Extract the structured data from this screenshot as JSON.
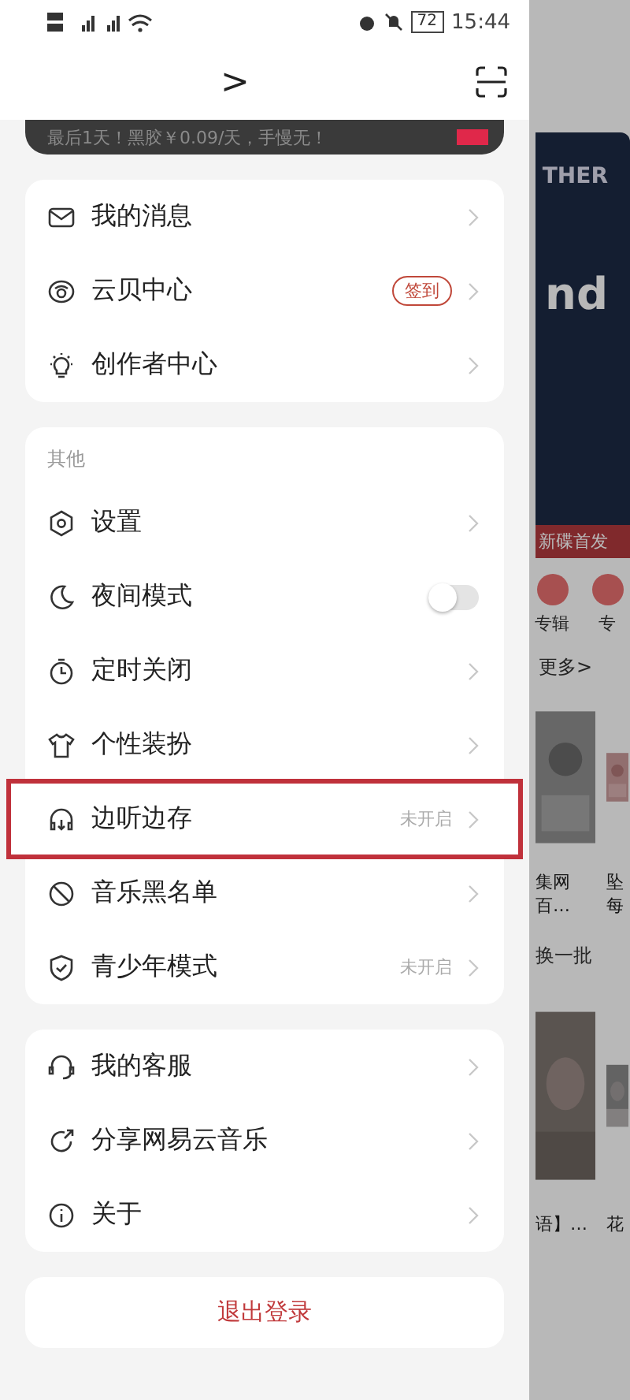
{
  "status_bar": {
    "time": "15:44",
    "battery": "72"
  },
  "header": {
    "chevron": ">"
  },
  "banner": {
    "text": "最后1天！黑胶￥0.09/天，手慢无！"
  },
  "sections": [
    {
      "items": [
        {
          "label": "我的消息"
        },
        {
          "label": "云贝中心",
          "badge": "签到"
        },
        {
          "label": "创作者中心"
        }
      ]
    },
    {
      "heading": "其他",
      "items": [
        {
          "label": "设置"
        },
        {
          "label": "夜间模式",
          "kind": "toggle",
          "on": false
        },
        {
          "label": "定时关闭"
        },
        {
          "label": "个性装扮"
        },
        {
          "label": "边听边存",
          "status": "未开启",
          "highlighted": true
        },
        {
          "label": "音乐黑名单"
        },
        {
          "label": "青少年模式",
          "status": "未开启"
        }
      ]
    },
    {
      "items": [
        {
          "label": "我的客服"
        },
        {
          "label": "分享网易云音乐"
        },
        {
          "label": "关于"
        }
      ]
    }
  ],
  "logout": "退出登录",
  "background": {
    "album_text": "THER",
    "album_text_2": "nd",
    "album_caption": "新碟首发",
    "shortcuts": [
      "专辑",
      "专"
    ],
    "more": "更多>",
    "card_titles": [
      {
        "line1": "集网",
        "line2": "百…"
      },
      {
        "line1": "坠",
        "line2": "每"
      }
    ],
    "refresh": "换一批",
    "card_titles_2": [
      "语】…",
      "花"
    ]
  }
}
